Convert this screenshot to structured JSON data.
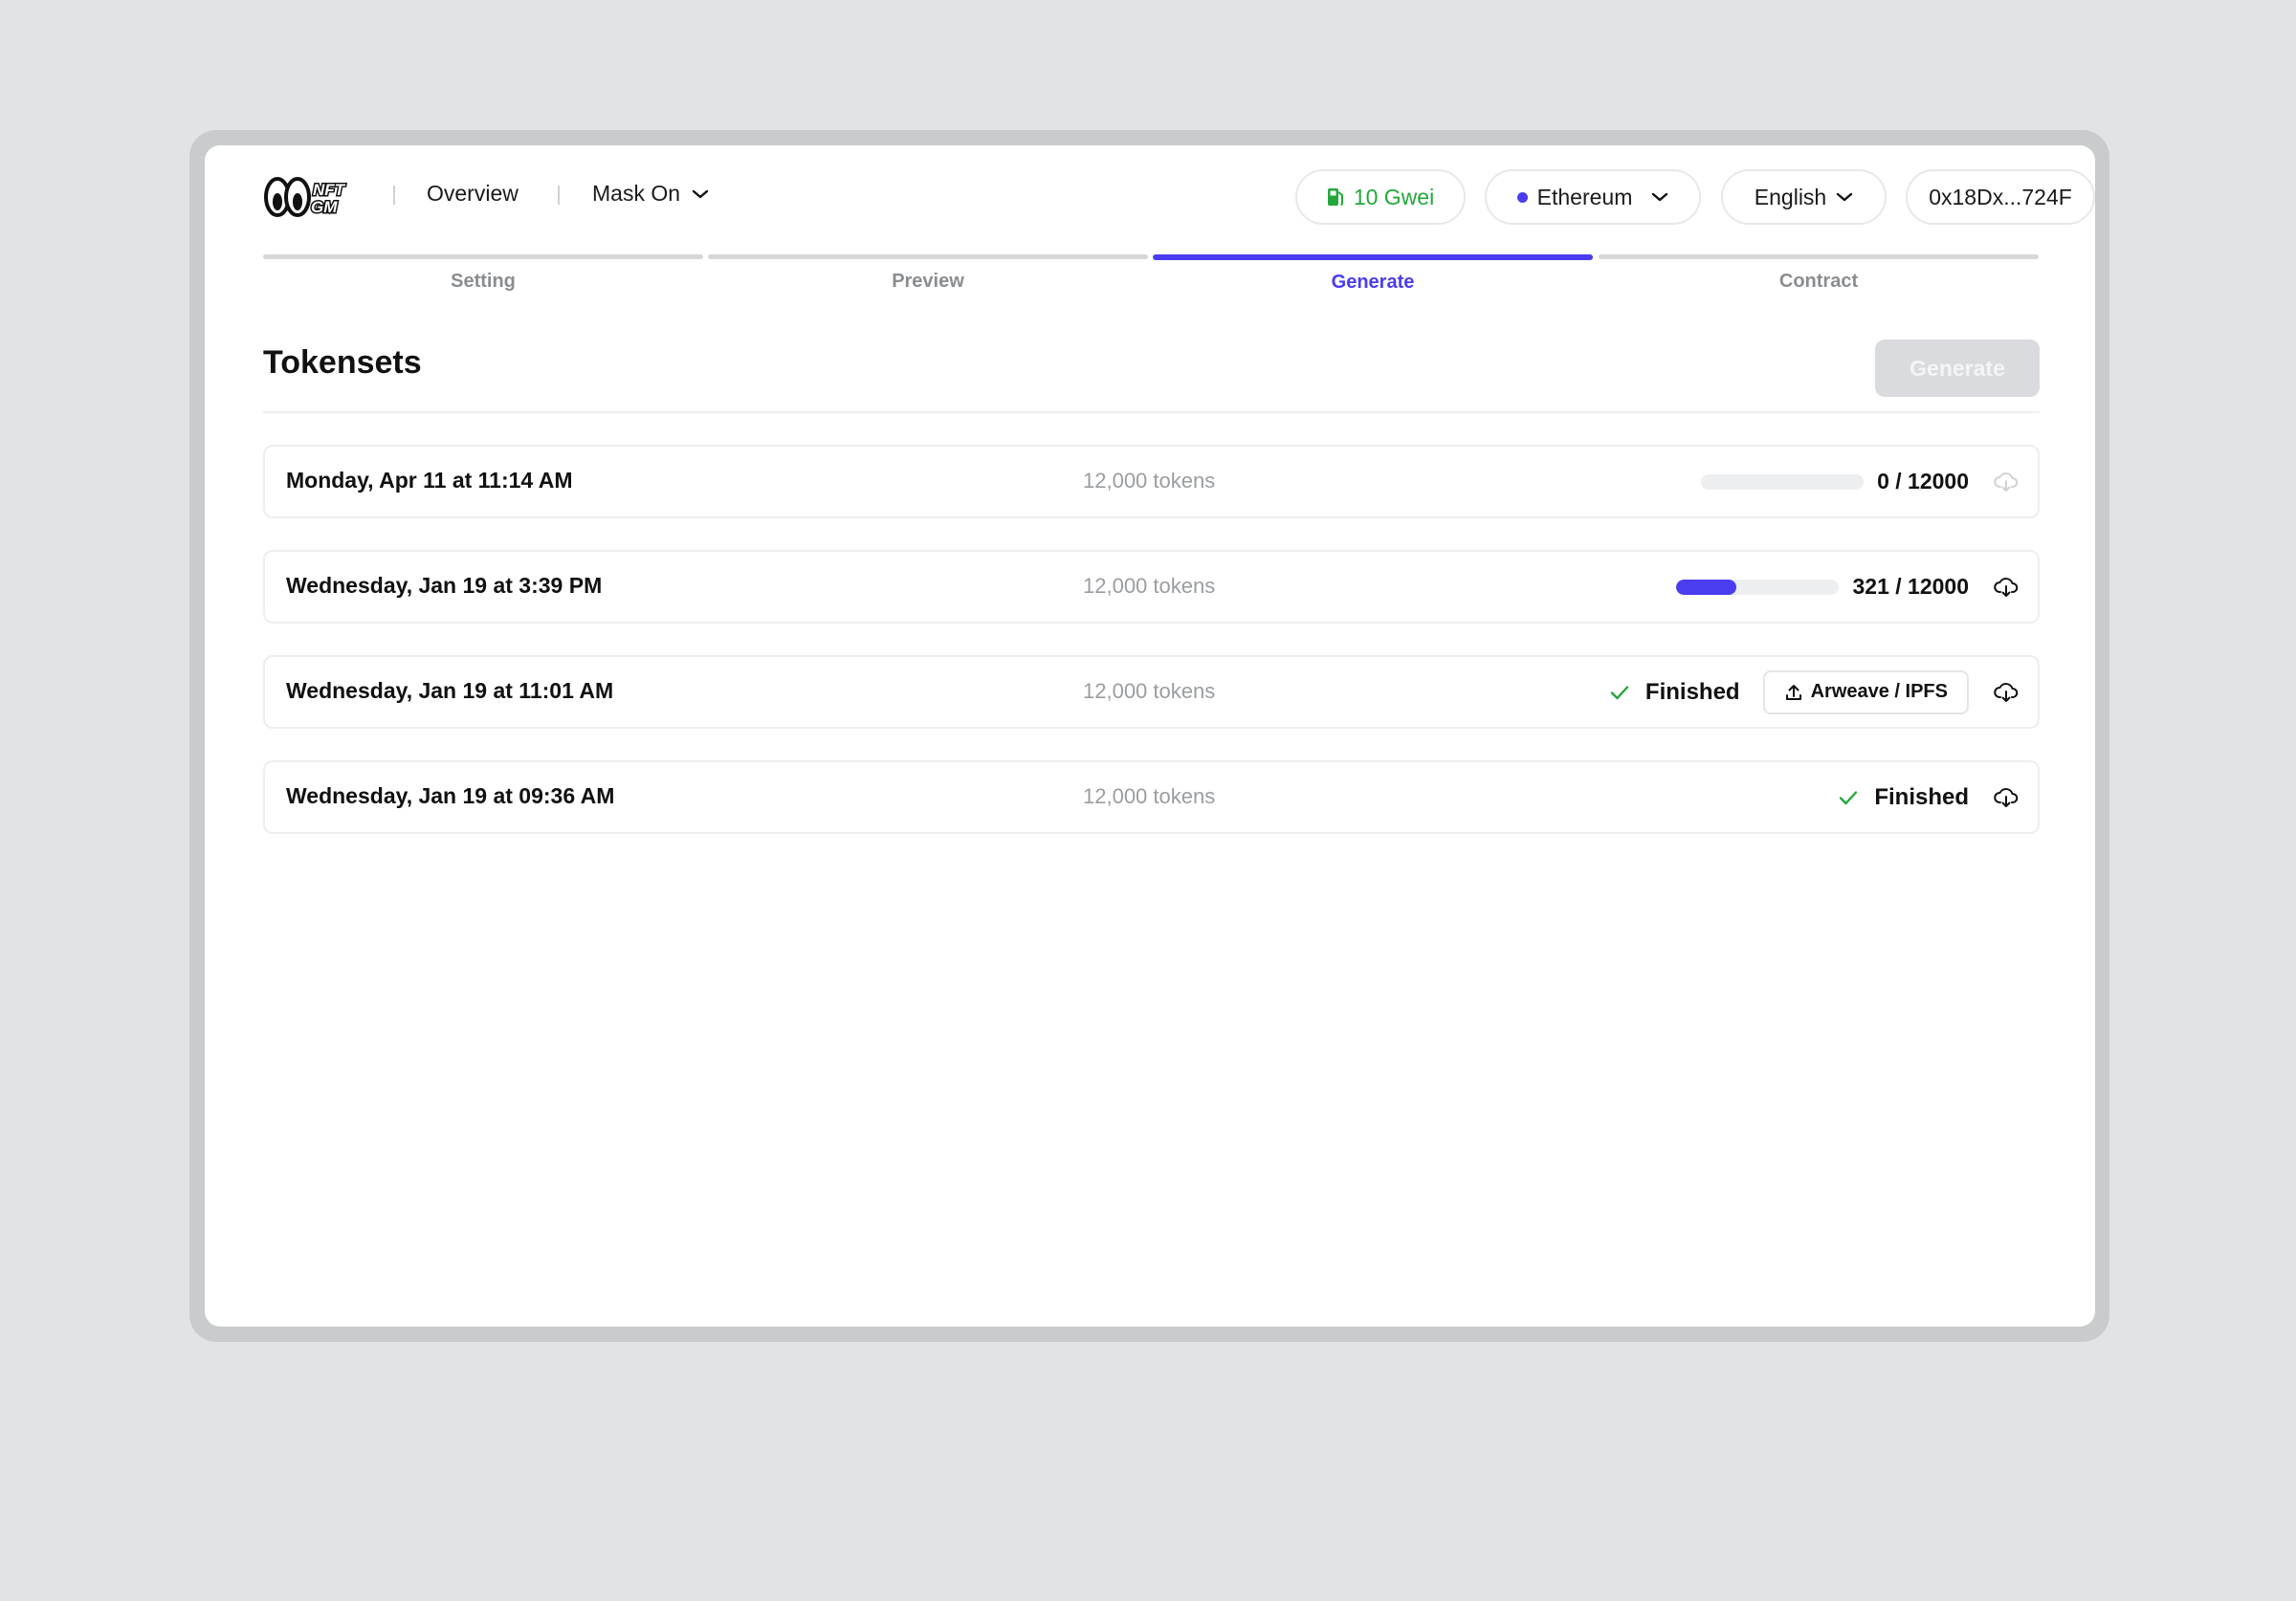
{
  "header": {
    "logo_text": "NFT GM",
    "nav_overview": "Overview",
    "nav_project": "Mask On",
    "gas": "10 Gwei",
    "network": "Ethereum",
    "language": "English",
    "wallet": "0x18Dx...724F"
  },
  "steps": [
    {
      "label": "Setting",
      "active": false
    },
    {
      "label": "Preview",
      "active": false
    },
    {
      "label": "Generate",
      "active": true
    },
    {
      "label": "Contract",
      "active": false
    }
  ],
  "main": {
    "title": "Tokensets",
    "generate_button": "Generate"
  },
  "tokensets": [
    {
      "date": "Monday, Apr 11 at 11:14 AM",
      "count": "12,000 tokens",
      "status": "progress",
      "progress_text": "0 / 12000",
      "progress_fraction": 0.0
    },
    {
      "date": "Wednesday, Jan 19 at 3:39 PM",
      "count": "12,000 tokens",
      "status": "progress",
      "progress_text": "321 / 12000",
      "progress_fraction": 0.37
    },
    {
      "date": "Wednesday, Jan 19 at 11:01 AM",
      "count": "12,000 tokens",
      "status": "finished",
      "status_text": "Finished",
      "upload_label": "Arweave / IPFS"
    },
    {
      "date": "Wednesday, Jan 19 at 09:36 AM",
      "count": "12,000 tokens",
      "status": "finished",
      "status_text": "Finished"
    }
  ],
  "colors": {
    "accent": "#4a3df0",
    "success": "#22a83a",
    "background": "#e1e4e5"
  }
}
